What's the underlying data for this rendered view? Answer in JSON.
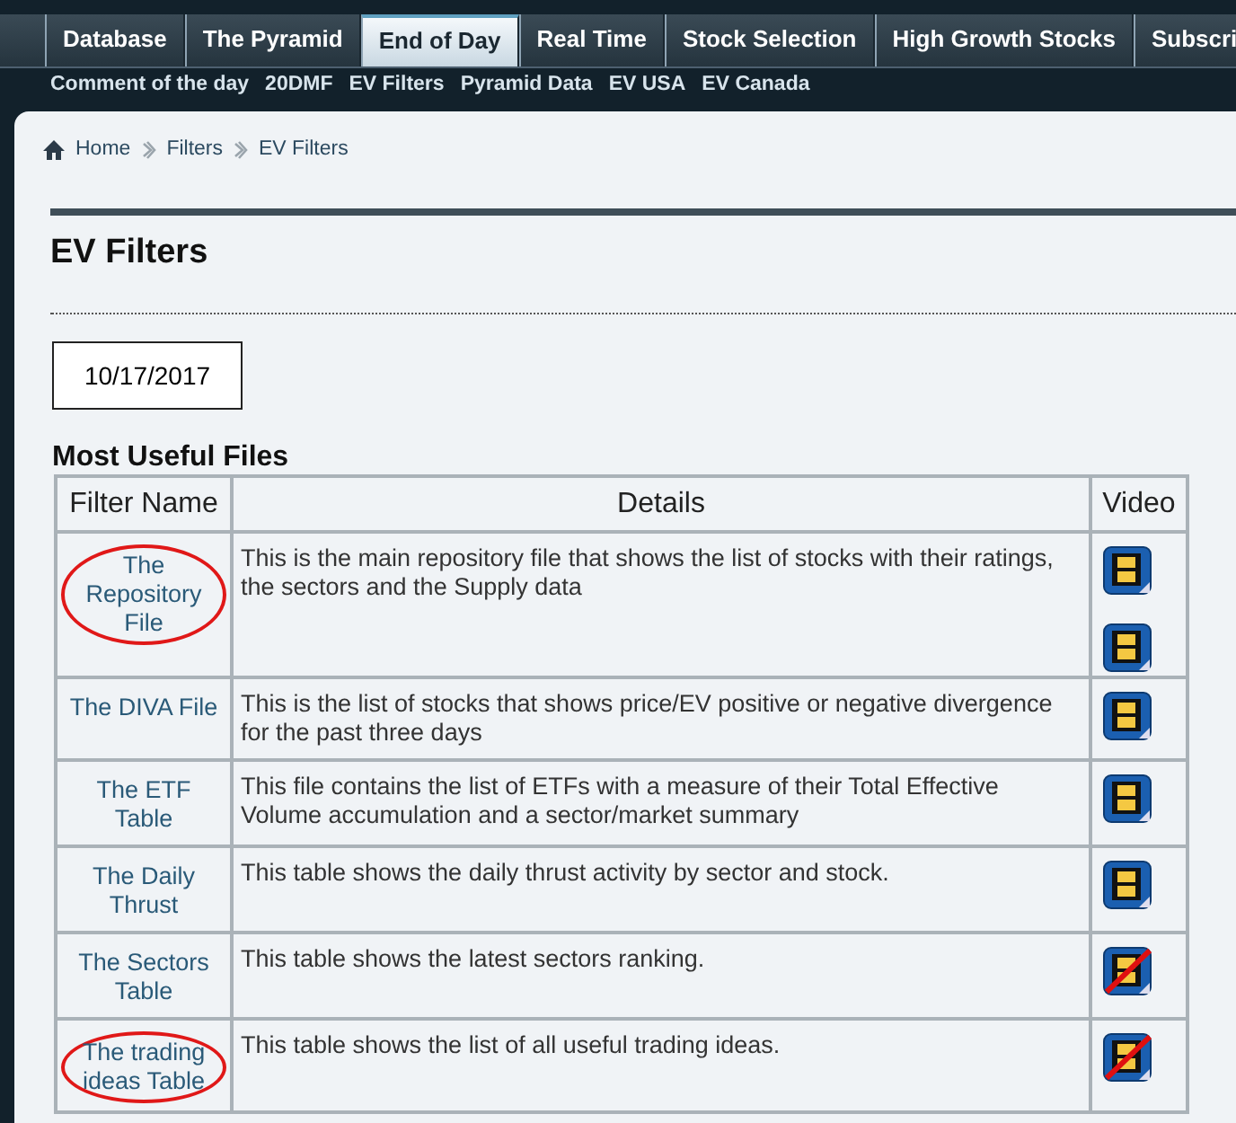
{
  "tabs": [
    {
      "label": "Database",
      "selected": false
    },
    {
      "label": "The Pyramid",
      "selected": false
    },
    {
      "label": "End of Day",
      "selected": true
    },
    {
      "label": "Real Time",
      "selected": false
    },
    {
      "label": "Stock Selection",
      "selected": false
    },
    {
      "label": "High Growth Stocks",
      "selected": false
    },
    {
      "label": "Subscri",
      "selected": false
    }
  ],
  "subnav": [
    "Comment of the day",
    "20DMF",
    "EV Filters",
    "Pyramid Data",
    "EV USA",
    "EV Canada"
  ],
  "breadcrumb": [
    "Home",
    "Filters",
    "EV Filters"
  ],
  "page_title": "EV Filters",
  "date": "10/17/2017",
  "section_title": "Most Useful Files",
  "table": {
    "columns": [
      "Filter Name",
      "Details",
      "Video"
    ],
    "rows": [
      {
        "name": "The Repository File",
        "details": "This is the main repository file that shows the list of stocks with their ratings, the sectors and the Supply data",
        "circled": true,
        "videos": [
          {
            "struck": false
          },
          {
            "struck": false
          }
        ]
      },
      {
        "name": "The DIVA File",
        "details": "This is the list of stocks that shows price/EV positive or negative divergence for the past three days",
        "circled": false,
        "videos": [
          {
            "struck": false
          }
        ]
      },
      {
        "name": "The ETF Table",
        "details": "This file contains the list of ETFs with a measure of their Total Effective Volume accumulation and a sector/market summary",
        "circled": false,
        "videos": [
          {
            "struck": false
          }
        ]
      },
      {
        "name": "The Daily Thrust",
        "details": "This table shows the daily thrust activity by sector and stock.",
        "circled": false,
        "videos": [
          {
            "struck": false
          }
        ]
      },
      {
        "name": "The Sectors Table",
        "details": "This table shows the latest sectors ranking.",
        "circled": false,
        "videos": [
          {
            "struck": true
          }
        ]
      },
      {
        "name": "The trading ideas Table",
        "details": "This table shows the list of all useful trading ideas.",
        "circled": true,
        "videos": [
          {
            "struck": true
          }
        ]
      }
    ]
  }
}
